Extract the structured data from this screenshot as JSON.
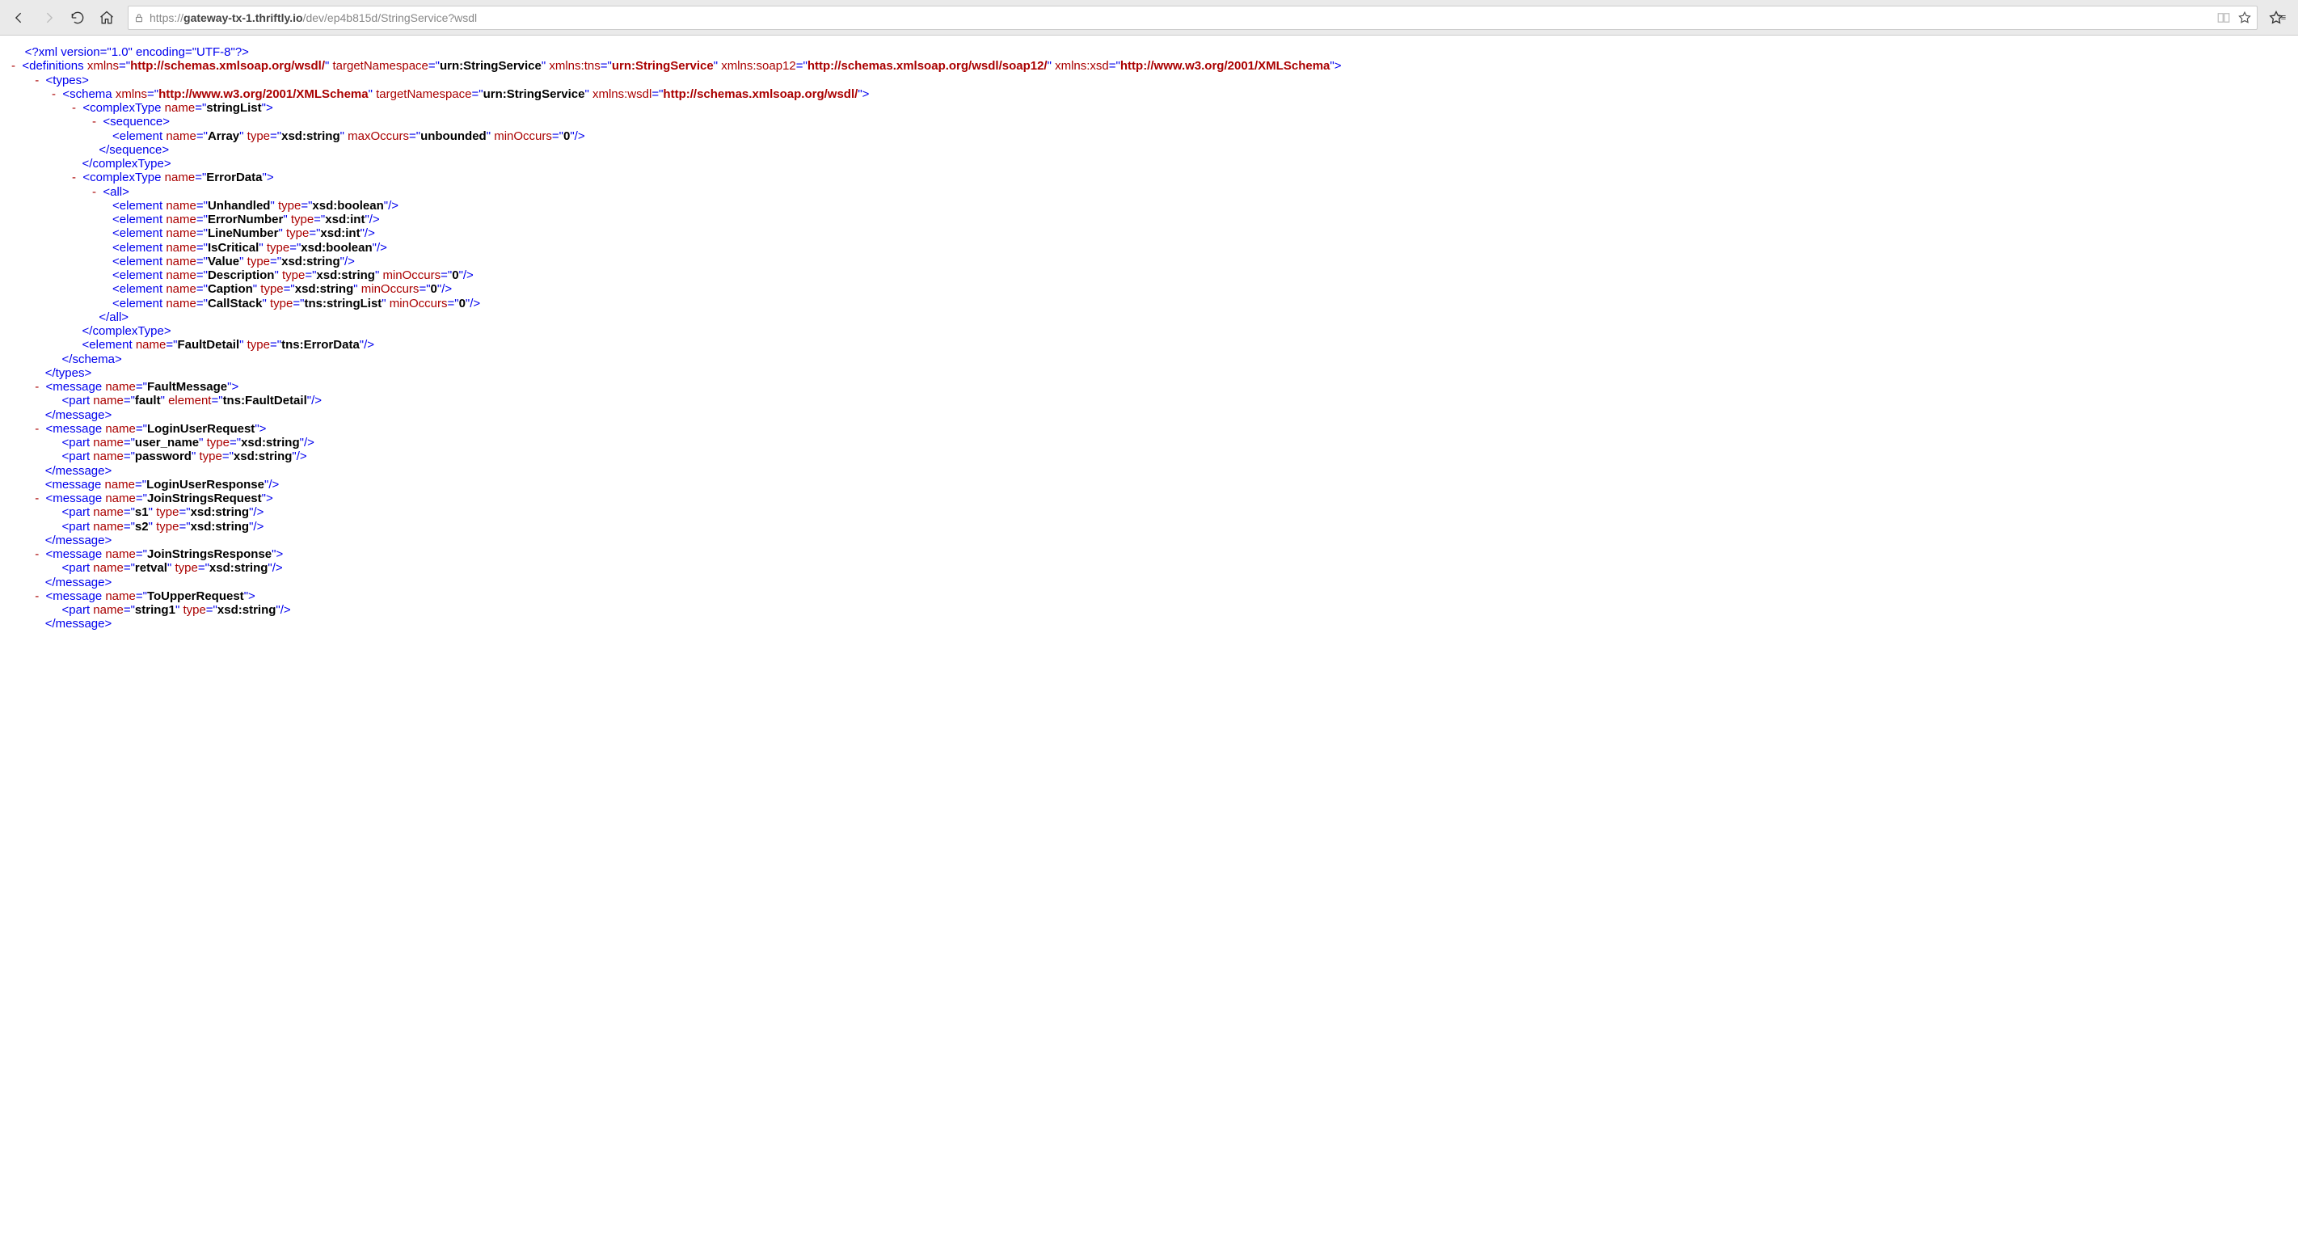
{
  "toolbar": {
    "url_prefix": "https://",
    "url_host": "gateway-tx-1.thriftly.io",
    "url_path": "/dev/ep4b815d/StringService?wsdl"
  },
  "xml": {
    "decl": "<?xml version=\"1.0\" encoding=\"UTF-8\"?>",
    "definitions": {
      "name": "definitions",
      "attrs": [
        {
          "n": "xmlns",
          "v": "http://schemas.xmlsoap.org/wsdl/",
          "link": true
        },
        {
          "n": "targetNamespace",
          "v": "urn:StringService"
        },
        {
          "n": "xmlns:tns",
          "v": "urn:StringService",
          "link": true
        },
        {
          "n": "xmlns:soap12",
          "v": "http://schemas.xmlsoap.org/wsdl/soap12/",
          "link": true
        },
        {
          "n": "xmlns:xsd",
          "v": "http://www.w3.org/2001/XMLSchema",
          "link": true
        }
      ]
    },
    "types": {
      "schema": {
        "attrs": [
          {
            "n": "xmlns",
            "v": "http://www.w3.org/2001/XMLSchema",
            "link": true
          },
          {
            "n": "targetNamespace",
            "v": "urn:StringService"
          },
          {
            "n": "xmlns:wsdl",
            "v": "http://schemas.xmlsoap.org/wsdl/",
            "link": true
          }
        ],
        "complexTypes": [
          {
            "name": "stringList",
            "container": "sequence",
            "elements": [
              {
                "attrs": [
                  {
                    "n": "name",
                    "v": "Array"
                  },
                  {
                    "n": "type",
                    "v": "xsd:string"
                  },
                  {
                    "n": "maxOccurs",
                    "v": "unbounded"
                  },
                  {
                    "n": "minOccurs",
                    "v": "0"
                  }
                ]
              }
            ]
          },
          {
            "name": "ErrorData",
            "container": "all",
            "elements": [
              {
                "attrs": [
                  {
                    "n": "name",
                    "v": "Unhandled"
                  },
                  {
                    "n": "type",
                    "v": "xsd:boolean"
                  }
                ]
              },
              {
                "attrs": [
                  {
                    "n": "name",
                    "v": "ErrorNumber"
                  },
                  {
                    "n": "type",
                    "v": "xsd:int"
                  }
                ]
              },
              {
                "attrs": [
                  {
                    "n": "name",
                    "v": "LineNumber"
                  },
                  {
                    "n": "type",
                    "v": "xsd:int"
                  }
                ]
              },
              {
                "attrs": [
                  {
                    "n": "name",
                    "v": "IsCritical"
                  },
                  {
                    "n": "type",
                    "v": "xsd:boolean"
                  }
                ]
              },
              {
                "attrs": [
                  {
                    "n": "name",
                    "v": "Value"
                  },
                  {
                    "n": "type",
                    "v": "xsd:string"
                  }
                ]
              },
              {
                "attrs": [
                  {
                    "n": "name",
                    "v": "Description"
                  },
                  {
                    "n": "type",
                    "v": "xsd:string"
                  },
                  {
                    "n": "minOccurs",
                    "v": "0"
                  }
                ]
              },
              {
                "attrs": [
                  {
                    "n": "name",
                    "v": "Caption"
                  },
                  {
                    "n": "type",
                    "v": "xsd:string"
                  },
                  {
                    "n": "minOccurs",
                    "v": "0"
                  }
                ]
              },
              {
                "attrs": [
                  {
                    "n": "name",
                    "v": "CallStack"
                  },
                  {
                    "n": "type",
                    "v": "tns:stringList"
                  },
                  {
                    "n": "minOccurs",
                    "v": "0"
                  }
                ]
              }
            ]
          }
        ],
        "faultElement": {
          "attrs": [
            {
              "n": "name",
              "v": "FaultDetail"
            },
            {
              "n": "type",
              "v": "tns:ErrorData"
            }
          ]
        }
      }
    },
    "messages": [
      {
        "name": "FaultMessage",
        "collapsed": false,
        "parts": [
          {
            "attrs": [
              {
                "n": "name",
                "v": "fault"
              },
              {
                "n": "element",
                "v": "tns:FaultDetail"
              }
            ]
          }
        ]
      },
      {
        "name": "LoginUserRequest",
        "collapsed": false,
        "parts": [
          {
            "attrs": [
              {
                "n": "name",
                "v": "user_name"
              },
              {
                "n": "type",
                "v": "xsd:string"
              }
            ]
          },
          {
            "attrs": [
              {
                "n": "name",
                "v": "password"
              },
              {
                "n": "type",
                "v": "xsd:string"
              }
            ]
          }
        ]
      },
      {
        "name": "LoginUserResponse",
        "collapsed": true,
        "parts": []
      },
      {
        "name": "JoinStringsRequest",
        "collapsed": false,
        "parts": [
          {
            "attrs": [
              {
                "n": "name",
                "v": "s1"
              },
              {
                "n": "type",
                "v": "xsd:string"
              }
            ]
          },
          {
            "attrs": [
              {
                "n": "name",
                "v": "s2"
              },
              {
                "n": "type",
                "v": "xsd:string"
              }
            ]
          }
        ]
      },
      {
        "name": "JoinStringsResponse",
        "collapsed": false,
        "parts": [
          {
            "attrs": [
              {
                "n": "name",
                "v": "retval"
              },
              {
                "n": "type",
                "v": "xsd:string"
              }
            ]
          }
        ]
      },
      {
        "name": "ToUpperRequest",
        "collapsed": false,
        "parts": [
          {
            "attrs": [
              {
                "n": "name",
                "v": "string1"
              },
              {
                "n": "type",
                "v": "xsd:string"
              }
            ]
          }
        ]
      }
    ]
  }
}
